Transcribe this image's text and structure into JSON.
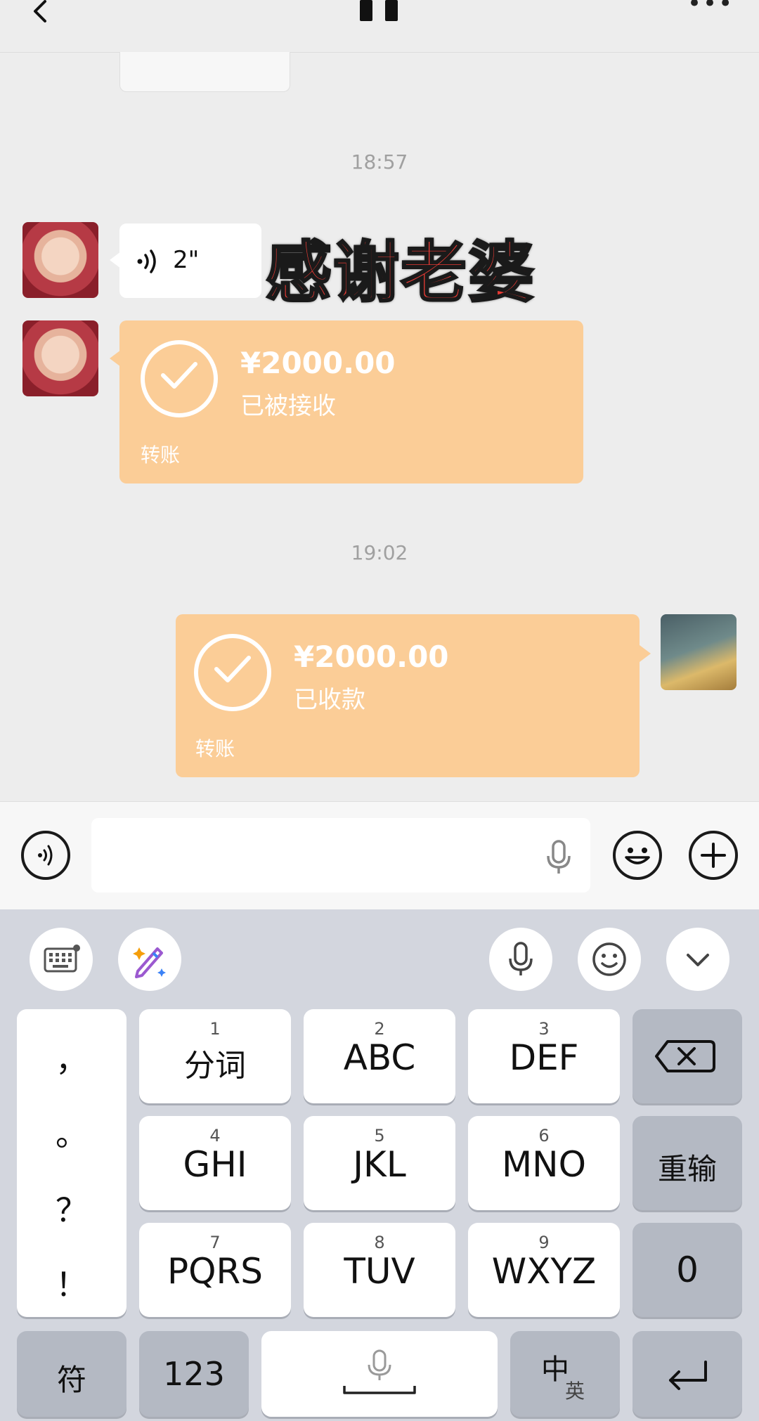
{
  "chat": {
    "time_1": "18:57",
    "voice_duration": "2\"",
    "overlay_caption": "感谢老婆",
    "transfer_received": {
      "amount": "¥2000.00",
      "status": "已被接收",
      "label": "转账"
    },
    "time_2": "19:02",
    "transfer_sent": {
      "amount": "¥2000.00",
      "status": "已收款",
      "label": "转账"
    }
  },
  "keyboard": {
    "punctuation": [
      "，",
      "。",
      "？",
      "！"
    ],
    "rows": [
      [
        {
          "num": "1",
          "label": "分词"
        },
        {
          "num": "2",
          "label": "ABC"
        },
        {
          "num": "3",
          "label": "DEF"
        }
      ],
      [
        {
          "num": "4",
          "label": "GHI"
        },
        {
          "num": "5",
          "label": "JKL"
        },
        {
          "num": "6",
          "label": "MNO"
        }
      ],
      [
        {
          "num": "7",
          "label": "PQRS"
        },
        {
          "num": "8",
          "label": "TUV"
        },
        {
          "num": "9",
          "label": "WXYZ"
        }
      ]
    ],
    "retype": "重输",
    "zero": "0",
    "symbols": "符",
    "numbers": "123",
    "lang_zh": "中",
    "lang_en": "英"
  },
  "icons": [
    "back-icon",
    "pause-icon",
    "more-icon",
    "voice-wave-icon",
    "check-icon",
    "microphone-icon",
    "emoji-icon",
    "plus-icon",
    "keyboard-icon",
    "magic-pen-icon",
    "chevron-down-icon",
    "backspace-icon",
    "enter-icon",
    "space-bar-icon"
  ],
  "colors": {
    "background": "#ededed",
    "transfer": "#fbcd97",
    "caption": "#e83a34",
    "keyboard": "#d3d6de"
  }
}
